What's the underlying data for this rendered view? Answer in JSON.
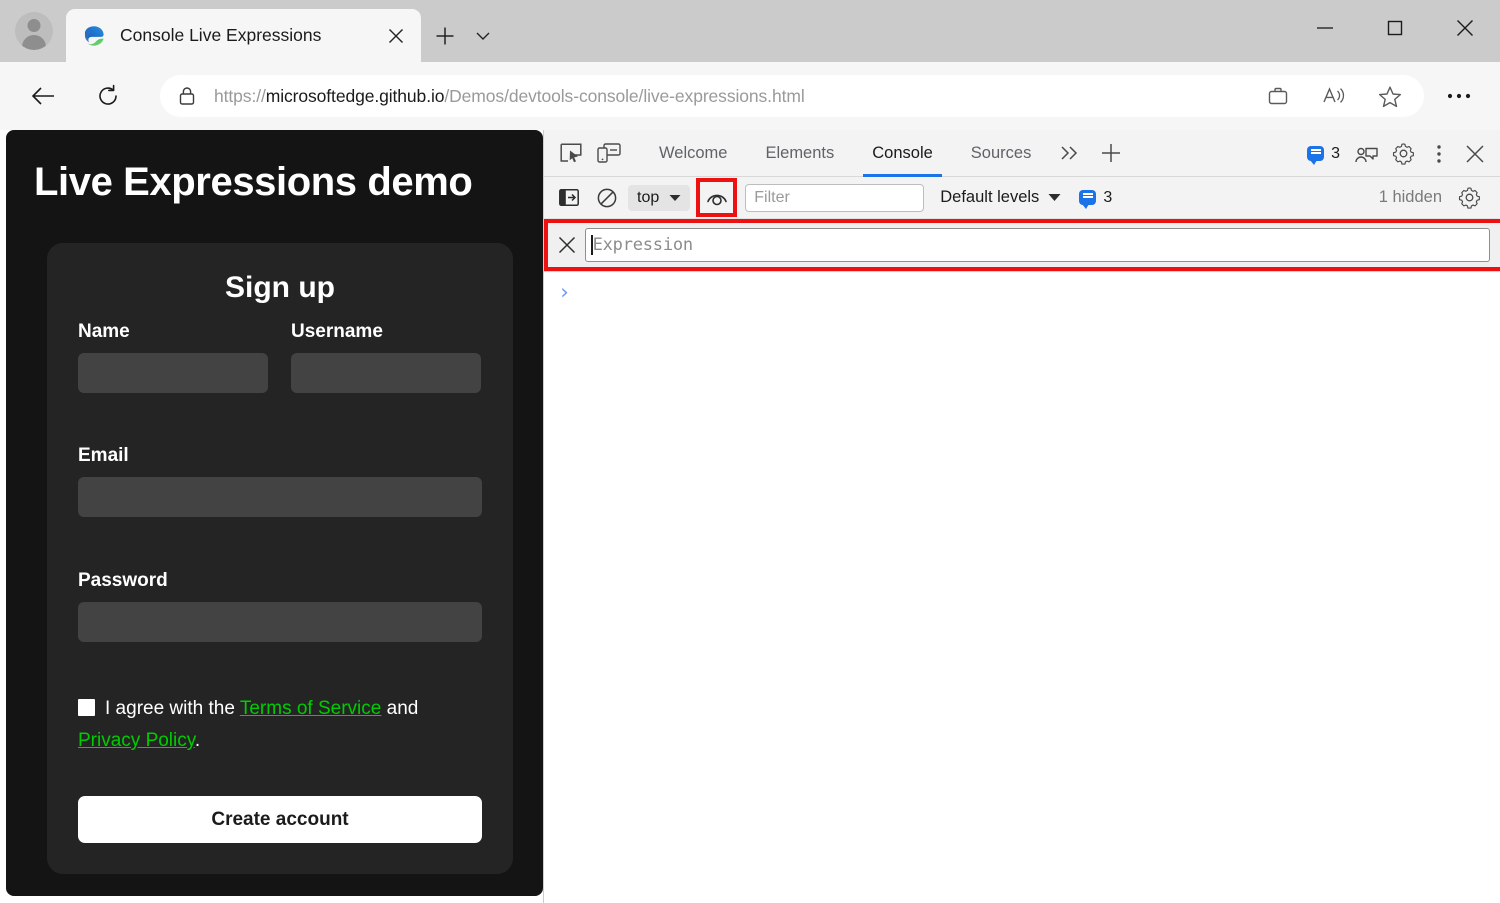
{
  "browser": {
    "profile_icon": "person-icon",
    "tab": {
      "title": "Console Live Expressions",
      "favicon": "edge-logo-icon",
      "close_label": "×"
    },
    "new_tab_label": "+",
    "tab_menu_label": "⌄",
    "window_controls": {
      "minimize": "−",
      "maximize": "□",
      "close": "×"
    },
    "nav": {
      "back": "back-arrow-icon",
      "reload": "reload-icon"
    },
    "address": {
      "lock_icon": "lock-icon",
      "scheme": "https://",
      "host": "microsoftedge.github.io",
      "path": "/Demos/devtools-console/live-expressions.html",
      "full_url": "https://microsoftedge.github.io/Demos/devtools-console/live-expressions.html"
    },
    "toolbar_icons": [
      {
        "name": "collections-icon",
        "label": "Collections"
      },
      {
        "name": "read-aloud-icon",
        "label": "Read aloud"
      },
      {
        "name": "favorites-star-icon",
        "label": "Favorites"
      },
      {
        "name": "settings-and-more-icon",
        "label": "Settings and more"
      }
    ]
  },
  "page": {
    "heading": "Live Expressions demo",
    "form": {
      "title": "Sign up",
      "fields": [
        {
          "label": "Name",
          "value": "",
          "type": "text"
        },
        {
          "label": "Username",
          "value": "",
          "type": "text"
        },
        {
          "label": "Email",
          "value": "",
          "type": "email"
        },
        {
          "label": "Password",
          "value": "",
          "type": "password"
        }
      ],
      "terms": {
        "prefix": "I agree with the ",
        "link1": "Terms of Service",
        "middle": " and ",
        "link2": "Privacy Policy",
        "suffix": ".",
        "checked": false,
        "link_color": "#00cc00"
      },
      "submit_label": "Create account"
    }
  },
  "devtools": {
    "dock_icons": [
      {
        "name": "inspect-element-icon"
      },
      {
        "name": "device-emulation-icon"
      }
    ],
    "tabs": [
      {
        "label": "Welcome",
        "active": false
      },
      {
        "label": "Elements",
        "active": false
      },
      {
        "label": "Console",
        "active": true
      },
      {
        "label": "Sources",
        "active": false
      }
    ],
    "more_tabs_label": "»",
    "add_tab_label": "+",
    "accent_color": "#1a73e8",
    "right_icons": [
      {
        "name": "issues-count",
        "count": "3"
      },
      {
        "name": "feedback-icon"
      },
      {
        "name": "settings-gear-icon"
      },
      {
        "name": "more-options-icon"
      },
      {
        "name": "close-devtools-icon"
      }
    ],
    "console_toolbar": {
      "sidebar_toggle": "console-sidebar-icon",
      "clear_console": "clear-console-icon",
      "context": "top",
      "context_chevron": "▼",
      "live_expression_icon": "eye-icon",
      "live_expression_highlighted": true,
      "filter_placeholder": "Filter",
      "filter_value": "",
      "levels_label": "Default levels",
      "levels_chevron": "▼",
      "message_count": "3",
      "hidden_label": "1 hidden",
      "settings_icon": "console-settings-gear-icon"
    },
    "live_expression": {
      "close_label": "×",
      "placeholder": "Expression",
      "value": "",
      "highlight_color": "#ee1111"
    },
    "console_prompt": "›"
  }
}
